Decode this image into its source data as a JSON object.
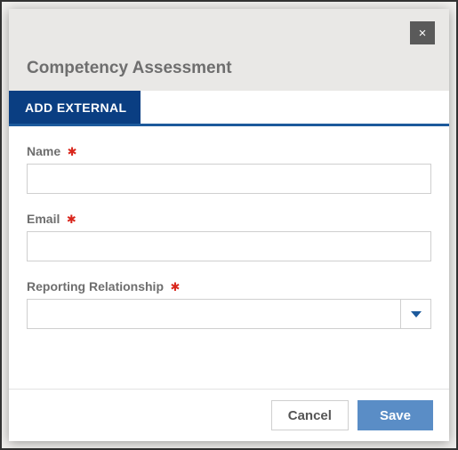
{
  "modal": {
    "title": "Competency Assessment",
    "close_label": "×"
  },
  "tabs": {
    "add_external": "ADD EXTERNAL"
  },
  "form": {
    "name": {
      "label": "Name",
      "value": ""
    },
    "email": {
      "label": "Email",
      "value": ""
    },
    "relationship": {
      "label": "Reporting Relationship",
      "value": ""
    }
  },
  "footer": {
    "cancel": "Cancel",
    "save": "Save"
  },
  "required_marker": "✱"
}
